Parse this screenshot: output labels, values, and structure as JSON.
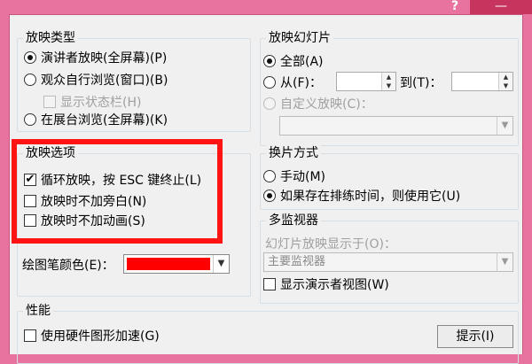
{
  "window": {
    "help_label": "?",
    "close_label": "—"
  },
  "show_type": {
    "title": "放映类型",
    "presenter": "演讲者放映(全屏幕)(P)",
    "individual": "观众自行浏览(窗口)(B)",
    "show_scrollbar": "显示状态栏(H)",
    "kiosk": "在展台浏览(全屏幕)(K)"
  },
  "show_slides": {
    "title": "放映幻灯片",
    "all": "全部(A)",
    "from": "从(F)：",
    "to": "到(T)：",
    "from_value": "",
    "to_value": "",
    "custom": "自定义放映(C)：",
    "custom_value": ""
  },
  "show_options": {
    "title": "放映选项",
    "loop": "循环放映，按 ESC 键终止(L)",
    "no_narration": "放映时不加旁白(N)",
    "no_animation": "放映时不加动画(S)",
    "pen_color_label": "绘图笔颜色(E)：",
    "pen_color": "#ff0000"
  },
  "advance": {
    "title": "换片方式",
    "manual": "手动(M)",
    "timings": "如果存在排练时间，则使用它(U)"
  },
  "monitors": {
    "title": "多监视器",
    "display_on": "幻灯片放映显示于(O)：",
    "display_value": "主要监视器",
    "presenter_view": "显示演示者视图(W)"
  },
  "performance": {
    "title": "性能",
    "hw_accel": "使用硬件图形加速(G)",
    "tips_button": "提示(I)"
  }
}
